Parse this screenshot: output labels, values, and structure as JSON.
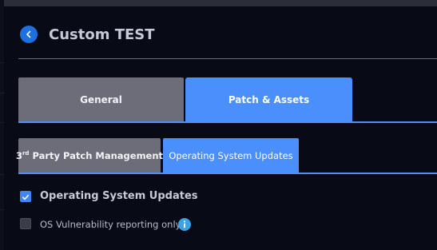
{
  "header": {
    "title": "Custom TEST",
    "back_icon": "chevron-left-icon"
  },
  "tabs": [
    {
      "label": "General",
      "active": false
    },
    {
      "label": "Patch & Assets",
      "active": true
    }
  ],
  "subtabs": [
    {
      "label_main": "3",
      "label_sup": "rd",
      "label_rest": " Party Patch Management",
      "active": false
    },
    {
      "label": "Operating System Updates",
      "active": true
    }
  ],
  "options": [
    {
      "label": "Operating System Updates",
      "checked": true
    },
    {
      "label": "OS Vulnerability reporting only",
      "checked": false,
      "info_icon": "info-icon"
    }
  ],
  "colors": {
    "accent": "#4a8ffb",
    "inactive_tab": "#6d6d79",
    "background": "#080a16",
    "info": "#3aa3e8"
  }
}
